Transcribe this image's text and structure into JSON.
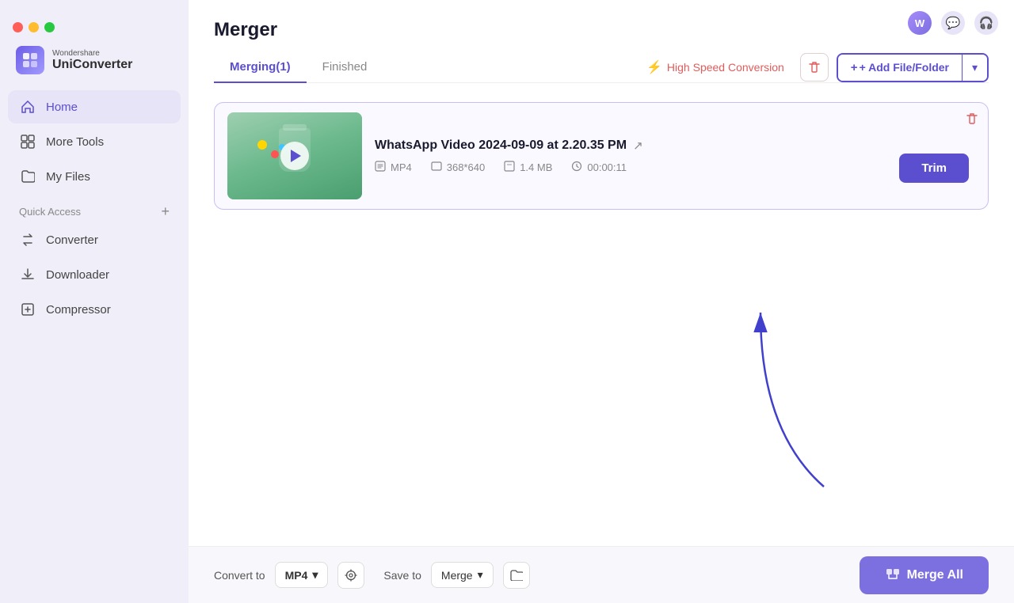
{
  "app": {
    "brand": "Wondershare",
    "name": "UniConverter",
    "logo_char": "U"
  },
  "sidebar": {
    "nav_items": [
      {
        "id": "home",
        "label": "Home",
        "icon": "⌂",
        "active": true
      },
      {
        "id": "more-tools",
        "label": "More Tools",
        "icon": "▦",
        "active": false
      },
      {
        "id": "my-files",
        "label": "My Files",
        "icon": "📁",
        "active": false
      }
    ],
    "quick_access_label": "Quick Access",
    "quick_access_items": [
      {
        "id": "converter",
        "label": "Converter",
        "icon": "⇄"
      },
      {
        "id": "downloader",
        "label": "Downloader",
        "icon": "⬇"
      },
      {
        "id": "compressor",
        "label": "Compressor",
        "icon": "⤓"
      }
    ]
  },
  "page": {
    "title": "Merger",
    "tabs": [
      {
        "id": "merging",
        "label": "Merging(1)",
        "active": true
      },
      {
        "id": "finished",
        "label": "Finished",
        "active": false
      }
    ],
    "speed_btn_label": "High Speed Conversion",
    "add_file_label": "+ Add File/Folder"
  },
  "file_card": {
    "name": "WhatsApp Video 2024-09-09 at 2.20.35 PM",
    "format": "MP4",
    "resolution": "368*640",
    "size": "1.4 MB",
    "duration": "00:00:11",
    "trim_label": "Trim"
  },
  "bottom_bar": {
    "convert_to_label": "Convert to",
    "format_value": "MP4",
    "save_to_label": "Save to",
    "save_value": "Merge",
    "merge_all_label": "Merge All"
  },
  "icons": {
    "traffic_red": "#ff5f57",
    "traffic_yellow": "#febc2e",
    "traffic_green": "#28c840"
  }
}
